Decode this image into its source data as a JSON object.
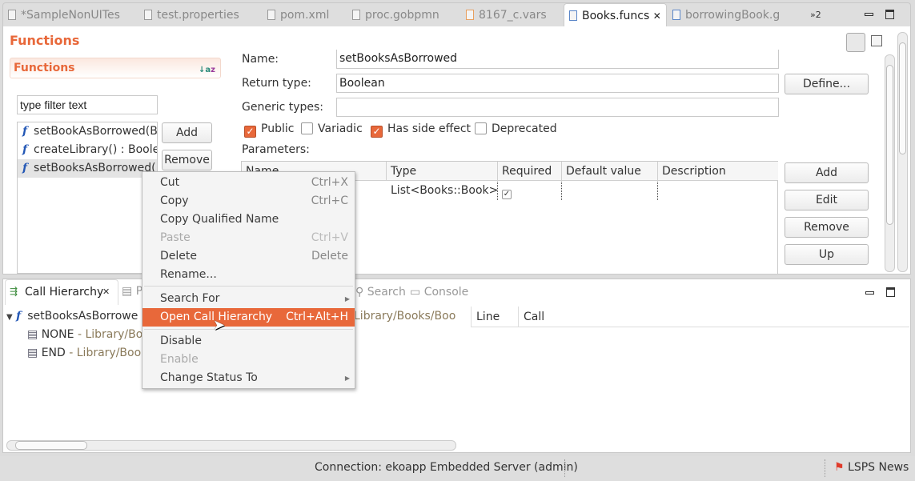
{
  "tabs": [
    {
      "label": "*SampleNonUITes",
      "active": false
    },
    {
      "label": "test.properties",
      "active": false
    },
    {
      "label": "pom.xml",
      "active": false
    },
    {
      "label": "proc.gobpmn",
      "active": false
    },
    {
      "label": "8167_c.vars",
      "active": false
    },
    {
      "label": "Books.funcs",
      "active": true
    },
    {
      "label": "borrowingBook.g",
      "active": false
    }
  ],
  "overflow_tabs": "»2",
  "editor": {
    "title": "Functions",
    "section_title": "Functions",
    "filter_placeholder": "type filter text",
    "functions": [
      "setBookAsBorrowed(B",
      "createLibrary() : Boole",
      "setBooksAsBorrowed("
    ],
    "selected_function": 2,
    "add_label": "Add",
    "remove_label": "Remove",
    "name_label": "Name:",
    "name_value": "setBooksAsBorrowed",
    "return_label": "Return type:",
    "return_value": "Boolean",
    "define_label": "Define...",
    "generic_label": "Generic types:",
    "generic_value": "",
    "checks": [
      {
        "label": "Public",
        "checked": true
      },
      {
        "label": "Variadic",
        "checked": false
      },
      {
        "label": "Has side effect",
        "checked": true
      },
      {
        "label": "Deprecated",
        "checked": false
      }
    ],
    "params_label": "Parameters:",
    "param_columns": [
      "Name",
      "Type",
      "Required",
      "Default value",
      "Description"
    ],
    "param_rows": [
      {
        "type": "List<Books::Book>",
        "required": true,
        "default": "",
        "description": ""
      }
    ],
    "param_buttons": [
      "Add",
      "Edit",
      "Remove",
      "Up"
    ]
  },
  "bottom": {
    "tabs": [
      "Call Hierarchy",
      "P",
      "Search",
      "Console"
    ],
    "tree": [
      {
        "label": "setBooksAsBorrowe",
        "path": ""
      },
      {
        "label": "NONE",
        "path": " - Library/Boo"
      },
      {
        "label": "END",
        "path": " - Library/Book"
      }
    ],
    "detail_path": "Library/Books/Boo",
    "columns": [
      "Line",
      "Call"
    ]
  },
  "context_menu": [
    {
      "label": "Cut",
      "shortcut": "Ctrl+X"
    },
    {
      "label": "Copy",
      "shortcut": "Ctrl+C"
    },
    {
      "label": "Copy Qualified Name",
      "shortcut": ""
    },
    {
      "label": "Paste",
      "shortcut": "Ctrl+V",
      "disabled": true
    },
    {
      "label": "Delete",
      "shortcut": "Delete"
    },
    {
      "label": "Rename...",
      "shortcut": ""
    },
    {
      "label": "Search For",
      "submenu": true
    },
    {
      "label": "Open Call Hierarchy",
      "shortcut": "Ctrl+Alt+H",
      "highlighted": true
    },
    {
      "label": "Disable",
      "shortcut": ""
    },
    {
      "label": "Enable",
      "shortcut": "",
      "disabled": true
    },
    {
      "label": "Change Status To",
      "submenu": true
    }
  ],
  "status": {
    "connection": "Connection: ekoapp Embedded Server (admin)",
    "news": "LSPS News"
  },
  "colors": {
    "accent": "#e8683a",
    "link": "#2357b5"
  }
}
